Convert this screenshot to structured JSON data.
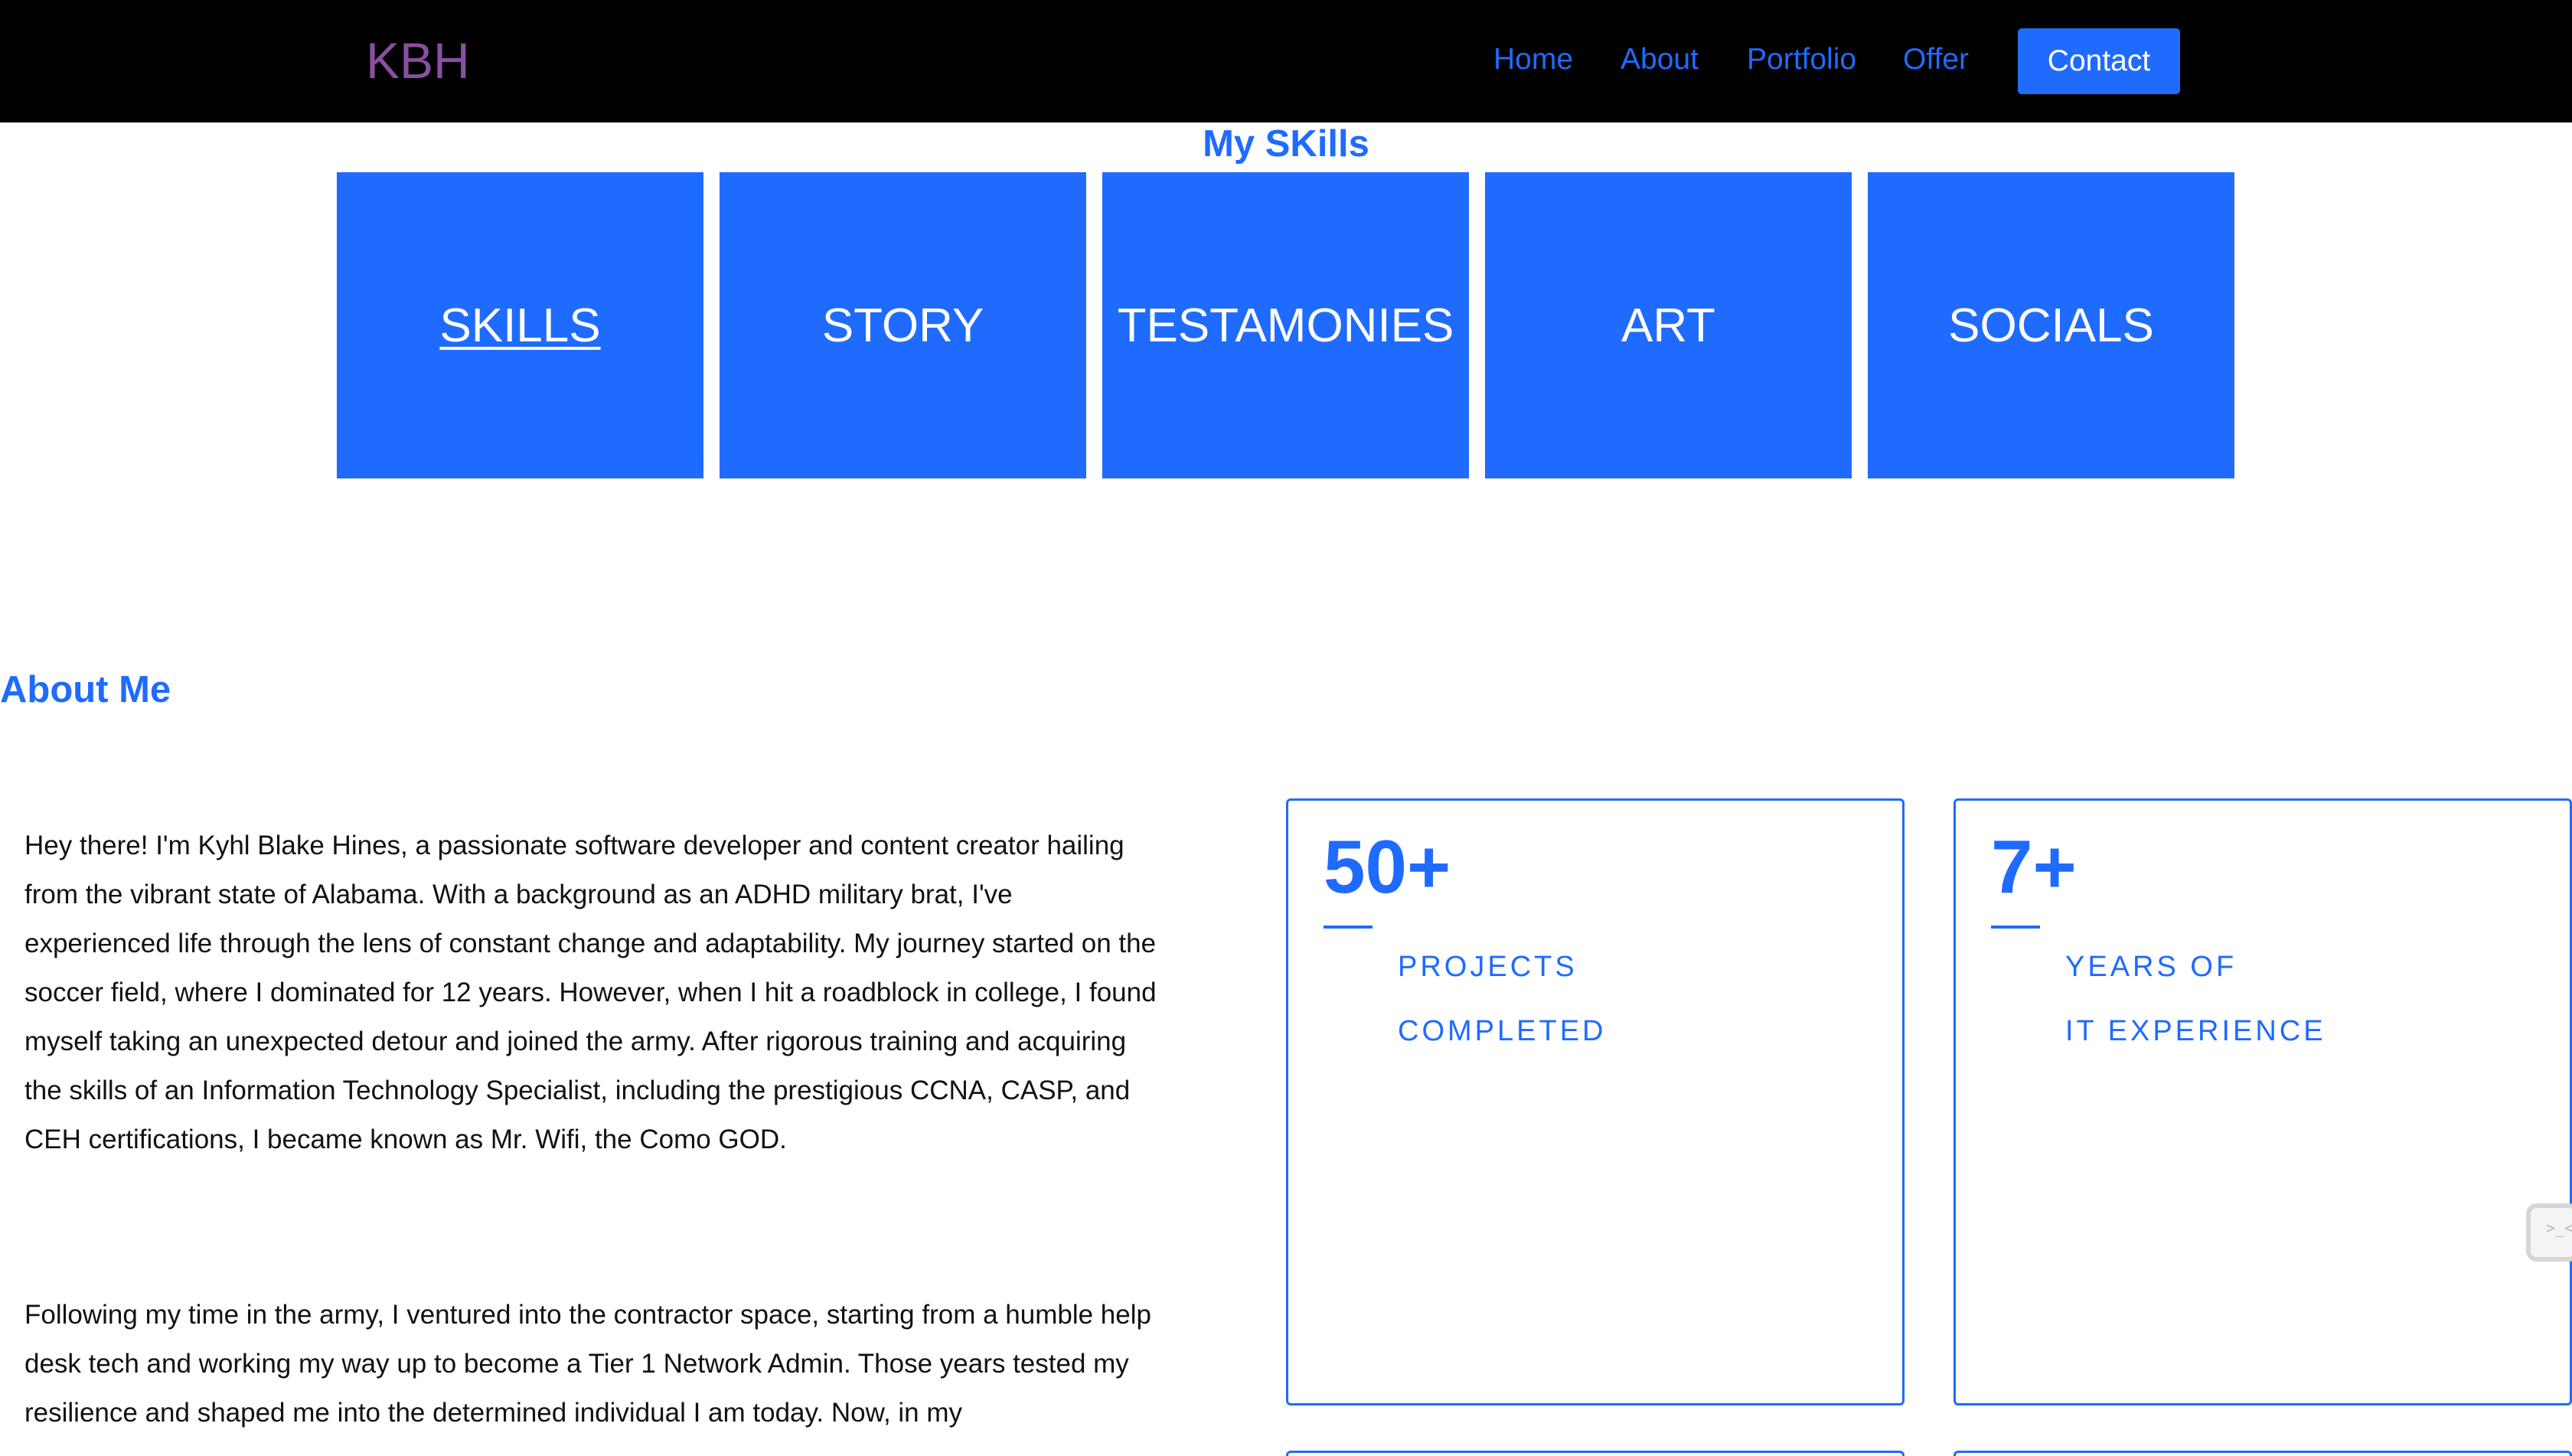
{
  "nav": {
    "logo": "KBH",
    "links": [
      "Home",
      "About",
      "Portfolio",
      "Offer"
    ],
    "contact_label": "Contact"
  },
  "skills": {
    "title": "My SKills",
    "tiles": [
      "SKILLS",
      "STORY",
      "TESTAMONIES",
      "ART",
      "SOCIALS"
    ]
  },
  "about": {
    "title": "About Me",
    "paragraphs": [
      "Hey there! I'm Kyhl Blake Hines, a passionate software developer and content creator hailing from the vibrant state of Alabama. With a background as an ADHD military brat, I've experienced life through the lens of constant change and adaptability. My journey started on the soccer field, where I dominated for 12 years. However, when I hit a roadblock in college, I found myself taking an unexpected detour and joined the army. After rigorous training and acquiring the skills of an Information Technology Specialist, including the prestigious CCNA, CASP, and CEH certifications, I became known as Mr. Wifi, the Como GOD.",
      "Following my time in the army, I ventured into the contractor space, starting from a humble help desk tech and working my way up to become a Tier 1 Network Admin. Those years tested my resilience and shaped me into the determined individual I am today. Now, in my"
    ]
  },
  "stats": [
    {
      "number": "50+",
      "label_line1": "PROJECTS",
      "label_line2": "COMPLETED"
    },
    {
      "number": "7+",
      "label_line1": "YEARS OF",
      "label_line2": "IT EXPERIENCE"
    }
  ],
  "colors": {
    "accent": "#1f6bff",
    "logo": "#8a4fa0",
    "nav_bg": "#000000"
  },
  "side_widget": {
    "icon": "collapsed-widget-icon"
  }
}
